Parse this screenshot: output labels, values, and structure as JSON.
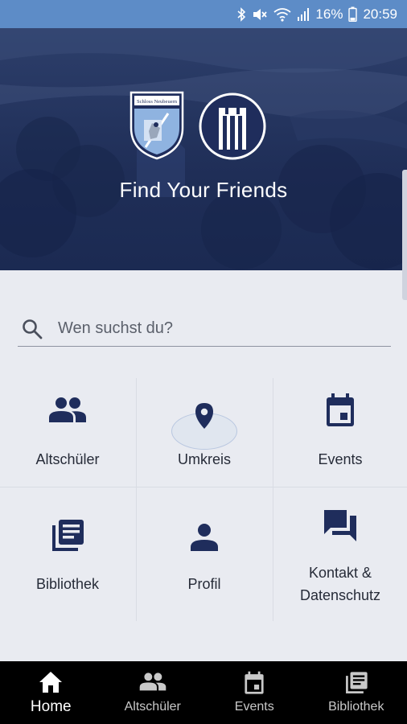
{
  "status_bar": {
    "battery": "16%",
    "time": "20:59",
    "icons": [
      "bluetooth-icon",
      "mute-icon",
      "wifi-icon",
      "signal-icon",
      "battery-icon"
    ]
  },
  "header": {
    "title": "Find Your Friends",
    "crest_text": "Schloss Neubeuern"
  },
  "search": {
    "placeholder": "Wen suchst du?",
    "value": ""
  },
  "menu": {
    "items": [
      {
        "label": "Altschüler",
        "icon": "people-icon"
      },
      {
        "label": "Umkreis",
        "icon": "location-pin-icon"
      },
      {
        "label": "Events",
        "icon": "calendar-icon"
      },
      {
        "label": "Bibliothek",
        "icon": "library-icon"
      },
      {
        "label": "Profil",
        "icon": "person-icon"
      },
      {
        "label": "Kontakt & Datenschutz",
        "icon": "chat-icon"
      }
    ]
  },
  "bottom_nav": {
    "tabs": [
      {
        "label": "Home",
        "icon": "home-icon",
        "active": true
      },
      {
        "label": "Altschüler",
        "icon": "people-icon",
        "active": false
      },
      {
        "label": "Events",
        "icon": "calendar-icon",
        "active": false
      },
      {
        "label": "Bibliothek",
        "icon": "library-icon",
        "active": false
      }
    ]
  },
  "colors": {
    "status_bar": "#5d8cc7",
    "hero": "#1f2e57",
    "icon": "#1f2d5c",
    "background": "#e9ebf1"
  }
}
